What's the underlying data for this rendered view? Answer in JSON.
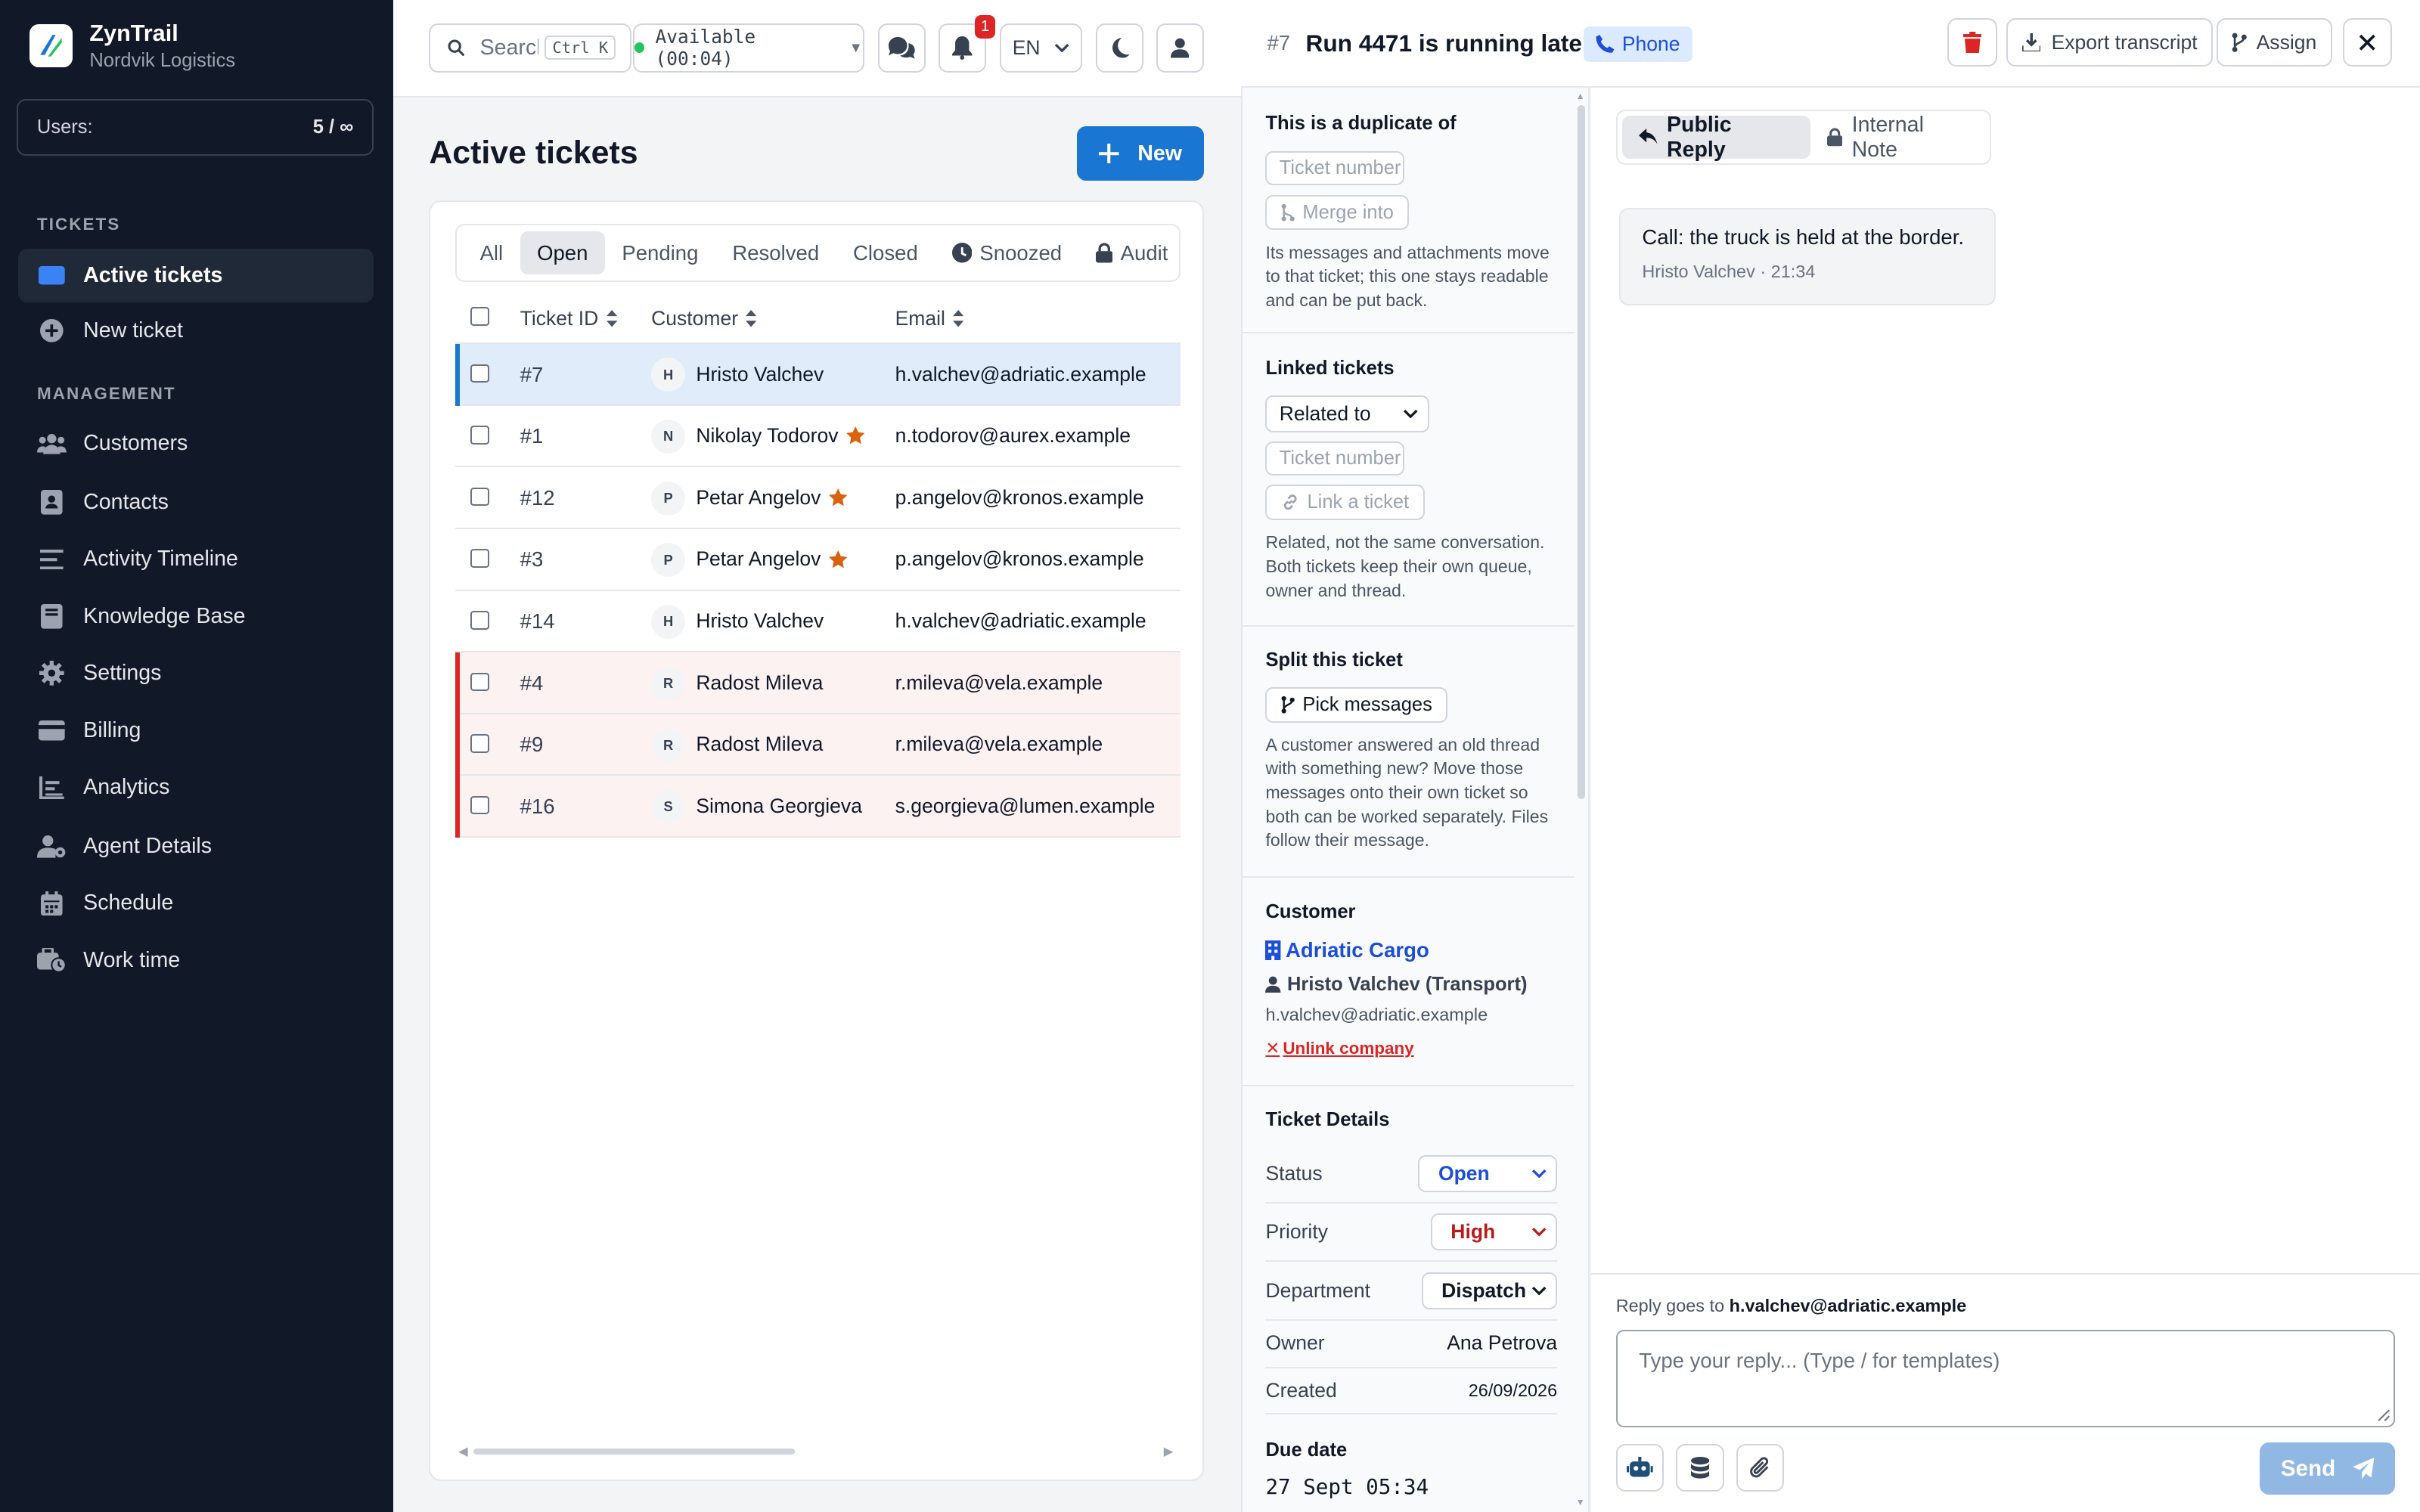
{
  "app": {
    "name": "ZynTrail",
    "org": "Nordvik Logistics"
  },
  "users": {
    "label": "Users:",
    "value": "5 / ∞"
  },
  "sidebar": {
    "section_tickets": "TICKETS",
    "section_management": "MANAGEMENT",
    "items": [
      {
        "label": "Active tickets",
        "icon": "ticket-icon"
      },
      {
        "label": "New ticket",
        "icon": "plus-circle-icon"
      },
      {
        "label": "Customers",
        "icon": "users-icon"
      },
      {
        "label": "Contacts",
        "icon": "contact-card-icon"
      },
      {
        "label": "Activity Timeline",
        "icon": "list-icon"
      },
      {
        "label": "Knowledge Base",
        "icon": "book-icon"
      },
      {
        "label": "Settings",
        "icon": "gear-icon"
      },
      {
        "label": "Billing",
        "icon": "credit-card-icon"
      },
      {
        "label": "Analytics",
        "icon": "chart-icon"
      },
      {
        "label": "Agent Details",
        "icon": "user-gear-icon"
      },
      {
        "label": "Schedule",
        "icon": "calendar-icon"
      },
      {
        "label": "Work time",
        "icon": "briefcase-clock-icon"
      }
    ]
  },
  "topbar": {
    "search_placeholder": "Search",
    "search_shortcut": "Ctrl K",
    "status": "Available (00:04)",
    "notifications_count": "1",
    "language": "EN"
  },
  "main": {
    "title": "Active tickets",
    "new_button": "New",
    "tabs": [
      "All",
      "Open",
      "Pending",
      "Resolved",
      "Closed",
      "Snoozed",
      "Audit"
    ],
    "active_tab": "Open",
    "columns": [
      "Ticket ID",
      "Customer",
      "Email"
    ],
    "rows": [
      {
        "id": "#7",
        "initial": "H",
        "customer": "Hristo Valchev",
        "email": "h.valchev@adriatic.example",
        "starred": false,
        "state": "selected"
      },
      {
        "id": "#1",
        "initial": "N",
        "customer": "Nikolay Todorov",
        "email": "n.todorov@aurex.example",
        "starred": true,
        "state": "normal"
      },
      {
        "id": "#12",
        "initial": "P",
        "customer": "Petar Angelov",
        "email": "p.angelov@kronos.example",
        "starred": true,
        "state": "normal"
      },
      {
        "id": "#3",
        "initial": "P",
        "customer": "Petar Angelov",
        "email": "p.angelov@kronos.example",
        "starred": true,
        "state": "normal"
      },
      {
        "id": "#14",
        "initial": "H",
        "customer": "Hristo Valchev",
        "email": "h.valchev@adriatic.example",
        "starred": false,
        "state": "normal"
      },
      {
        "id": "#4",
        "initial": "R",
        "customer": "Radost Mileva",
        "email": "r.mileva@vela.example",
        "starred": false,
        "state": "urgent"
      },
      {
        "id": "#9",
        "initial": "R",
        "customer": "Radost Mileva",
        "email": "r.mileva@vela.example",
        "starred": false,
        "state": "urgent"
      },
      {
        "id": "#16",
        "initial": "S",
        "customer": "Simona Georgieva",
        "email": "s.georgieva@lumen.example",
        "starred": false,
        "state": "urgent"
      }
    ]
  },
  "ticket": {
    "number": "#7",
    "title": "Run 4471 is running late",
    "channel": "Phone",
    "export_label": "Export transcript",
    "assign_label": "Assign"
  },
  "duplicate": {
    "title": "This is a duplicate of",
    "placeholder": "Ticket number",
    "merge_label": "Merge into",
    "help": "Its messages and attachments move to that ticket; this one stays readable and can be put back."
  },
  "linked": {
    "title": "Linked tickets",
    "relation": "Related to",
    "placeholder": "Ticket number",
    "link_label": "Link a ticket",
    "help": "Related, not the same conversation. Both tickets keep their own queue, owner and thread."
  },
  "split": {
    "title": "Split this ticket",
    "button": "Pick messages",
    "help": "A customer answered an old thread with something new? Move those messages onto their own ticket so both can be worked separately. Files follow their message."
  },
  "customer": {
    "title": "Customer",
    "company": "Adriatic Cargo",
    "contact": "Hristo Valchev (Transport)",
    "email": "h.valchev@adriatic.example",
    "unlink": "Unlink company"
  },
  "details": {
    "title": "Ticket Details",
    "status_label": "Status",
    "status": "Open",
    "priority_label": "Priority",
    "priority": "High",
    "department_label": "Department",
    "department": "Dispatch",
    "owner_label": "Owner",
    "owner": "Ana Petrova",
    "created_label": "Created",
    "created": "26/09/2026",
    "due_label": "Due date",
    "due": "27 Sept 05:34"
  },
  "reply": {
    "tab_public": "Public Reply",
    "tab_internal": "Internal Note",
    "message": "Call: the truck is held at the border.",
    "message_meta": "Hristo Valchev · 21:34",
    "reply_to_label": "Reply goes to",
    "reply_to": "h.valchev@adriatic.example",
    "placeholder": "Type your reply... (Type / for templates)",
    "send": "Send"
  },
  "colors": {
    "accent": "#1976d2",
    "sidebar_bg": "#111827",
    "urgent": "#dc2626",
    "star": "#d9620c",
    "send_disabled": "#90b8e3"
  }
}
